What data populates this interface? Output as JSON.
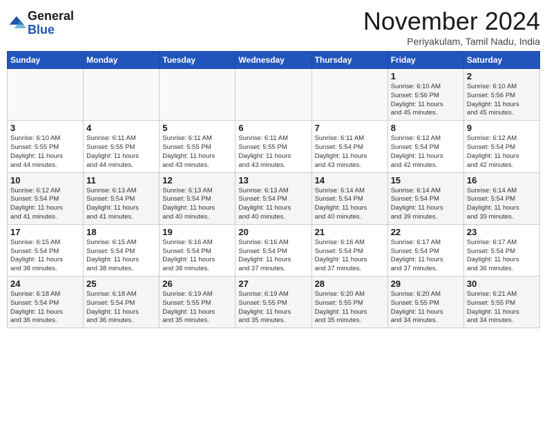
{
  "header": {
    "logo_line1": "General",
    "logo_line2": "Blue",
    "month": "November 2024",
    "location": "Periyakulam, Tamil Nadu, India"
  },
  "weekdays": [
    "Sunday",
    "Monday",
    "Tuesday",
    "Wednesday",
    "Thursday",
    "Friday",
    "Saturday"
  ],
  "weeks": [
    [
      {
        "day": "",
        "info": ""
      },
      {
        "day": "",
        "info": ""
      },
      {
        "day": "",
        "info": ""
      },
      {
        "day": "",
        "info": ""
      },
      {
        "day": "",
        "info": ""
      },
      {
        "day": "1",
        "info": "Sunrise: 6:10 AM\nSunset: 5:56 PM\nDaylight: 11 hours\nand 45 minutes."
      },
      {
        "day": "2",
        "info": "Sunrise: 6:10 AM\nSunset: 5:56 PM\nDaylight: 11 hours\nand 45 minutes."
      }
    ],
    [
      {
        "day": "3",
        "info": "Sunrise: 6:10 AM\nSunset: 5:55 PM\nDaylight: 11 hours\nand 44 minutes."
      },
      {
        "day": "4",
        "info": "Sunrise: 6:11 AM\nSunset: 5:55 PM\nDaylight: 11 hours\nand 44 minutes."
      },
      {
        "day": "5",
        "info": "Sunrise: 6:11 AM\nSunset: 5:55 PM\nDaylight: 11 hours\nand 43 minutes."
      },
      {
        "day": "6",
        "info": "Sunrise: 6:11 AM\nSunset: 5:55 PM\nDaylight: 11 hours\nand 43 minutes."
      },
      {
        "day": "7",
        "info": "Sunrise: 6:11 AM\nSunset: 5:54 PM\nDaylight: 11 hours\nand 43 minutes."
      },
      {
        "day": "8",
        "info": "Sunrise: 6:12 AM\nSunset: 5:54 PM\nDaylight: 11 hours\nand 42 minutes."
      },
      {
        "day": "9",
        "info": "Sunrise: 6:12 AM\nSunset: 5:54 PM\nDaylight: 11 hours\nand 42 minutes."
      }
    ],
    [
      {
        "day": "10",
        "info": "Sunrise: 6:12 AM\nSunset: 5:54 PM\nDaylight: 11 hours\nand 41 minutes."
      },
      {
        "day": "11",
        "info": "Sunrise: 6:13 AM\nSunset: 5:54 PM\nDaylight: 11 hours\nand 41 minutes."
      },
      {
        "day": "12",
        "info": "Sunrise: 6:13 AM\nSunset: 5:54 PM\nDaylight: 11 hours\nand 40 minutes."
      },
      {
        "day": "13",
        "info": "Sunrise: 6:13 AM\nSunset: 5:54 PM\nDaylight: 11 hours\nand 40 minutes."
      },
      {
        "day": "14",
        "info": "Sunrise: 6:14 AM\nSunset: 5:54 PM\nDaylight: 11 hours\nand 40 minutes."
      },
      {
        "day": "15",
        "info": "Sunrise: 6:14 AM\nSunset: 5:54 PM\nDaylight: 11 hours\nand 39 minutes."
      },
      {
        "day": "16",
        "info": "Sunrise: 6:14 AM\nSunset: 5:54 PM\nDaylight: 11 hours\nand 39 minutes."
      }
    ],
    [
      {
        "day": "17",
        "info": "Sunrise: 6:15 AM\nSunset: 5:54 PM\nDaylight: 11 hours\nand 38 minutes."
      },
      {
        "day": "18",
        "info": "Sunrise: 6:15 AM\nSunset: 5:54 PM\nDaylight: 11 hours\nand 38 minutes."
      },
      {
        "day": "19",
        "info": "Sunrise: 6:16 AM\nSunset: 5:54 PM\nDaylight: 11 hours\nand 38 minutes."
      },
      {
        "day": "20",
        "info": "Sunrise: 6:16 AM\nSunset: 5:54 PM\nDaylight: 11 hours\nand 37 minutes."
      },
      {
        "day": "21",
        "info": "Sunrise: 6:16 AM\nSunset: 5:54 PM\nDaylight: 11 hours\nand 37 minutes."
      },
      {
        "day": "22",
        "info": "Sunrise: 6:17 AM\nSunset: 5:54 PM\nDaylight: 11 hours\nand 37 minutes."
      },
      {
        "day": "23",
        "info": "Sunrise: 6:17 AM\nSunset: 5:54 PM\nDaylight: 11 hours\nand 36 minutes."
      }
    ],
    [
      {
        "day": "24",
        "info": "Sunrise: 6:18 AM\nSunset: 5:54 PM\nDaylight: 11 hours\nand 36 minutes."
      },
      {
        "day": "25",
        "info": "Sunrise: 6:18 AM\nSunset: 5:54 PM\nDaylight: 11 hours\nand 36 minutes."
      },
      {
        "day": "26",
        "info": "Sunrise: 6:19 AM\nSunset: 5:55 PM\nDaylight: 11 hours\nand 35 minutes."
      },
      {
        "day": "27",
        "info": "Sunrise: 6:19 AM\nSunset: 5:55 PM\nDaylight: 11 hours\nand 35 minutes."
      },
      {
        "day": "28",
        "info": "Sunrise: 6:20 AM\nSunset: 5:55 PM\nDaylight: 11 hours\nand 35 minutes."
      },
      {
        "day": "29",
        "info": "Sunrise: 6:20 AM\nSunset: 5:55 PM\nDaylight: 11 hours\nand 34 minutes."
      },
      {
        "day": "30",
        "info": "Sunrise: 6:21 AM\nSunset: 5:55 PM\nDaylight: 11 hours\nand 34 minutes."
      }
    ]
  ]
}
